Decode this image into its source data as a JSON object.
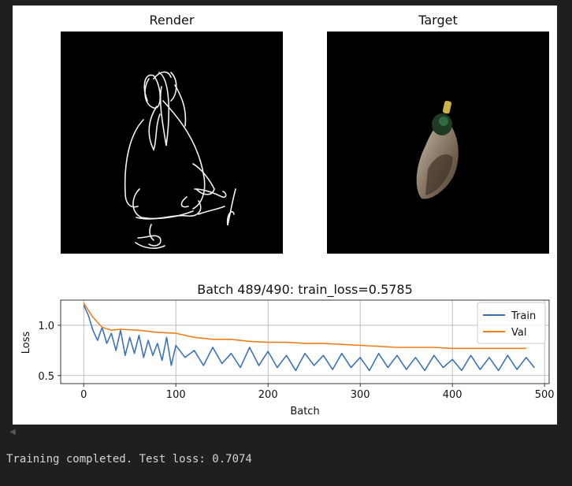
{
  "figure": {
    "left_title": "Render",
    "right_title": "Target"
  },
  "chart_data": {
    "type": "line",
    "title": "Batch 489/490: train_loss=0.5785",
    "xlabel": "Batch",
    "ylabel": "Loss",
    "xlim": [
      -25,
      505
    ],
    "ylim": [
      0.42,
      1.25
    ],
    "xticks": [
      0,
      100,
      200,
      300,
      400,
      500
    ],
    "yticks": [
      0.5,
      1.0
    ],
    "ytick_labels": [
      "0.5",
      "1.0"
    ],
    "grid": true,
    "legend": "top-right",
    "series": [
      {
        "name": "Train",
        "color": "#3b73b9",
        "x": [
          0,
          5,
          10,
          15,
          20,
          25,
          30,
          35,
          40,
          45,
          50,
          55,
          60,
          65,
          70,
          75,
          80,
          85,
          90,
          95,
          100,
          110,
          120,
          130,
          140,
          150,
          160,
          170,
          180,
          190,
          200,
          210,
          220,
          230,
          240,
          250,
          260,
          270,
          280,
          290,
          300,
          310,
          320,
          330,
          340,
          350,
          360,
          370,
          380,
          390,
          400,
          410,
          420,
          430,
          440,
          450,
          460,
          470,
          480,
          489
        ],
        "y": [
          1.2,
          1.1,
          0.95,
          0.85,
          0.98,
          0.82,
          0.92,
          0.75,
          0.95,
          0.7,
          0.88,
          0.72,
          0.9,
          0.68,
          0.85,
          0.7,
          0.82,
          0.65,
          0.88,
          0.6,
          0.8,
          0.68,
          0.75,
          0.6,
          0.78,
          0.62,
          0.72,
          0.58,
          0.78,
          0.6,
          0.74,
          0.58,
          0.7,
          0.55,
          0.72,
          0.6,
          0.7,
          0.56,
          0.72,
          0.58,
          0.68,
          0.55,
          0.72,
          0.58,
          0.7,
          0.56,
          0.68,
          0.55,
          0.7,
          0.58,
          0.66,
          0.55,
          0.7,
          0.56,
          0.68,
          0.55,
          0.7,
          0.56,
          0.68,
          0.5785
        ]
      },
      {
        "name": "Val",
        "color": "#f07f1a",
        "x": [
          0,
          10,
          20,
          30,
          40,
          60,
          80,
          100,
          120,
          140,
          160,
          180,
          200,
          220,
          240,
          260,
          280,
          300,
          320,
          340,
          360,
          380,
          400,
          420,
          440,
          460,
          480
        ],
        "y": [
          1.22,
          1.08,
          0.98,
          0.95,
          0.96,
          0.95,
          0.93,
          0.92,
          0.88,
          0.86,
          0.86,
          0.84,
          0.83,
          0.83,
          0.82,
          0.82,
          0.81,
          0.8,
          0.79,
          0.78,
          0.78,
          0.78,
          0.77,
          0.77,
          0.77,
          0.77,
          0.77
        ]
      }
    ]
  },
  "output": {
    "text": "Training completed. Test loss: 0.7074"
  }
}
